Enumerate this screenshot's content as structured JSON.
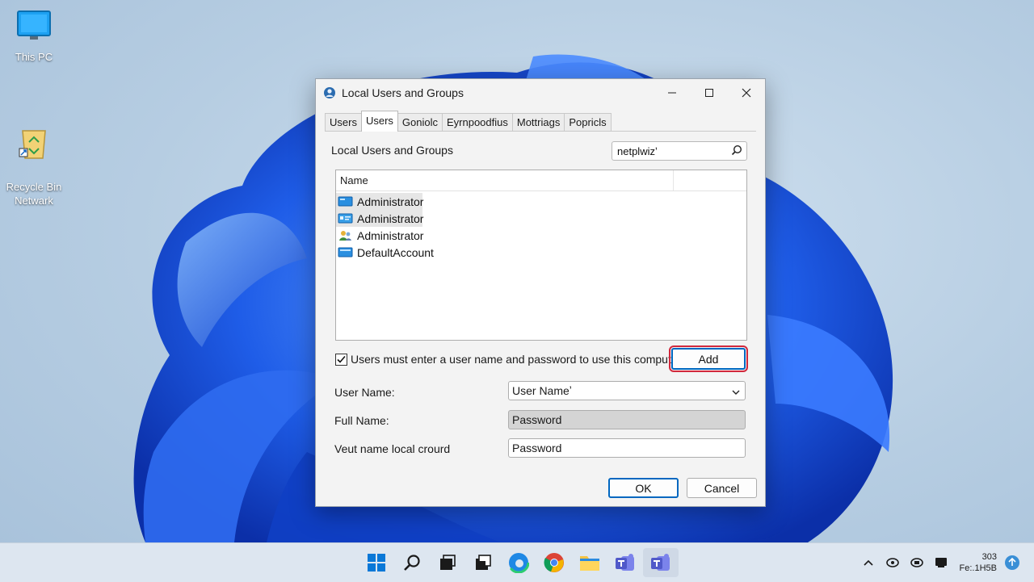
{
  "desktop": {
    "icons": [
      {
        "label": "This PC"
      },
      {
        "label": "Recycle Bin\nNetwark"
      }
    ]
  },
  "window": {
    "title": "Local Users and Groups",
    "tabs": [
      "Users",
      "Users",
      "Goniolc",
      "Eyrnpoodfius",
      "Mottriags",
      "Popricls"
    ],
    "active_tab_index": 1,
    "section_label": "Local Users and Groups",
    "search_value": "netplwizʼ",
    "list": {
      "column_header": "Name",
      "rows": [
        {
          "name": "Administrator",
          "icon": "user-monitor-icon",
          "selected": true
        },
        {
          "name": "Administrator",
          "icon": "user-card-icon",
          "selected": true
        },
        {
          "name": "Administrator",
          "icon": "user-group-icon",
          "selected": false
        },
        {
          "name": "DefaultAccount",
          "icon": "user-monitor-icon",
          "selected": false
        }
      ]
    },
    "checkbox_label": "Users must enter a user name and password to use this computer",
    "checkbox_checked": true,
    "add_button": "Add",
    "form": {
      "user_name_label": "User Name:",
      "user_name_value": "User Nameʼ",
      "full_name_label": "Full Name:",
      "full_name_value": "Password",
      "third_label": "Veut name local crourd",
      "third_value": "Password"
    },
    "ok_button": "OK",
    "cancel_button": "Cancel"
  },
  "taskbar": {
    "apps": [
      "start-icon",
      "search-icon",
      "task-view-icon",
      "widgets-icon",
      "edge-icon",
      "chrome-icon",
      "file-explorer-icon",
      "teams-icon",
      "teams-icon"
    ],
    "clock_time": "303",
    "clock_date": "Fe:.1H5B"
  },
  "colors": {
    "accent": "#0067c0",
    "highlight_red": "#d1283c",
    "wallpaper_blue": "#1a56e0"
  }
}
